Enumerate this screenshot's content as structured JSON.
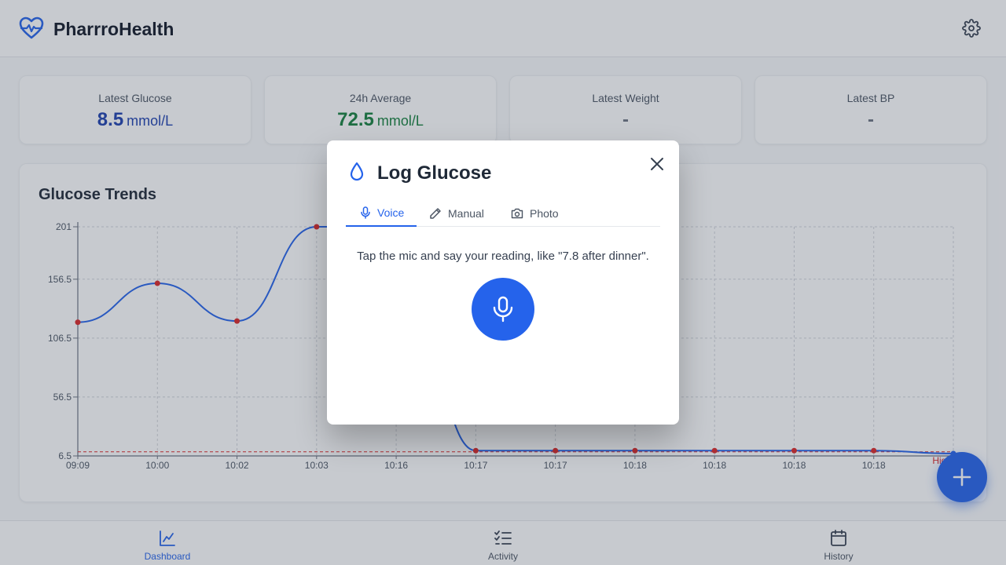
{
  "app": {
    "name": "PharrroHealth"
  },
  "stats": [
    {
      "label": "Latest Glucose",
      "value": "8.5",
      "unit": "mmol/L",
      "color": "#1e40af"
    },
    {
      "label": "24h Average",
      "value": "72.5",
      "unit": "mmol/L",
      "color": "#15803d"
    },
    {
      "label": "Latest Weight",
      "value": "-",
      "unit": ""
    },
    {
      "label": "Latest BP",
      "value": "-",
      "unit": ""
    }
  ],
  "chart": {
    "title": "Glucose Trends",
    "threshold_label": "High"
  },
  "chart_data": {
    "type": "line",
    "title": "Glucose Trends",
    "xlabel": "",
    "ylabel": "",
    "x": [
      "09:09",
      "10:00",
      "10:02",
      "10:03",
      "10:16",
      "10:17",
      "10:17",
      "10:18",
      "10:18",
      "10:18",
      "10:18",
      ""
    ],
    "series": [
      {
        "values": [
          120,
          153,
          121,
          201,
          201,
          11,
          11,
          11,
          11,
          11,
          11,
          8.5
        ]
      }
    ],
    "yticks": [
      "201",
      "156.5",
      "106.5",
      "56.5",
      "6.5"
    ],
    "ylim": [
      6.5,
      201
    ],
    "threshold": {
      "label": "High",
      "value": 10
    },
    "grid": true,
    "line_color": "#2563eb",
    "point_color": "#dc2626"
  },
  "nav": [
    {
      "label": "Dashboard",
      "icon": "chart-line-icon",
      "active": true
    },
    {
      "label": "Activity",
      "icon": "checklist-icon",
      "active": false
    },
    {
      "label": "History",
      "icon": "calendar-icon",
      "active": false
    }
  ],
  "modal": {
    "title": "Log Glucose",
    "icon": "droplet-icon",
    "tabs": [
      {
        "label": "Voice",
        "icon": "mic-icon",
        "active": true
      },
      {
        "label": "Manual",
        "icon": "pencil-icon",
        "active": false
      },
      {
        "label": "Photo",
        "icon": "camera-icon",
        "active": false
      }
    ],
    "hint": "Tap the mic and say your reading, like \"7.8 after dinner\"."
  },
  "colors": {
    "accent": "#2563eb",
    "danger": "#dc2626",
    "success": "#15803d"
  }
}
